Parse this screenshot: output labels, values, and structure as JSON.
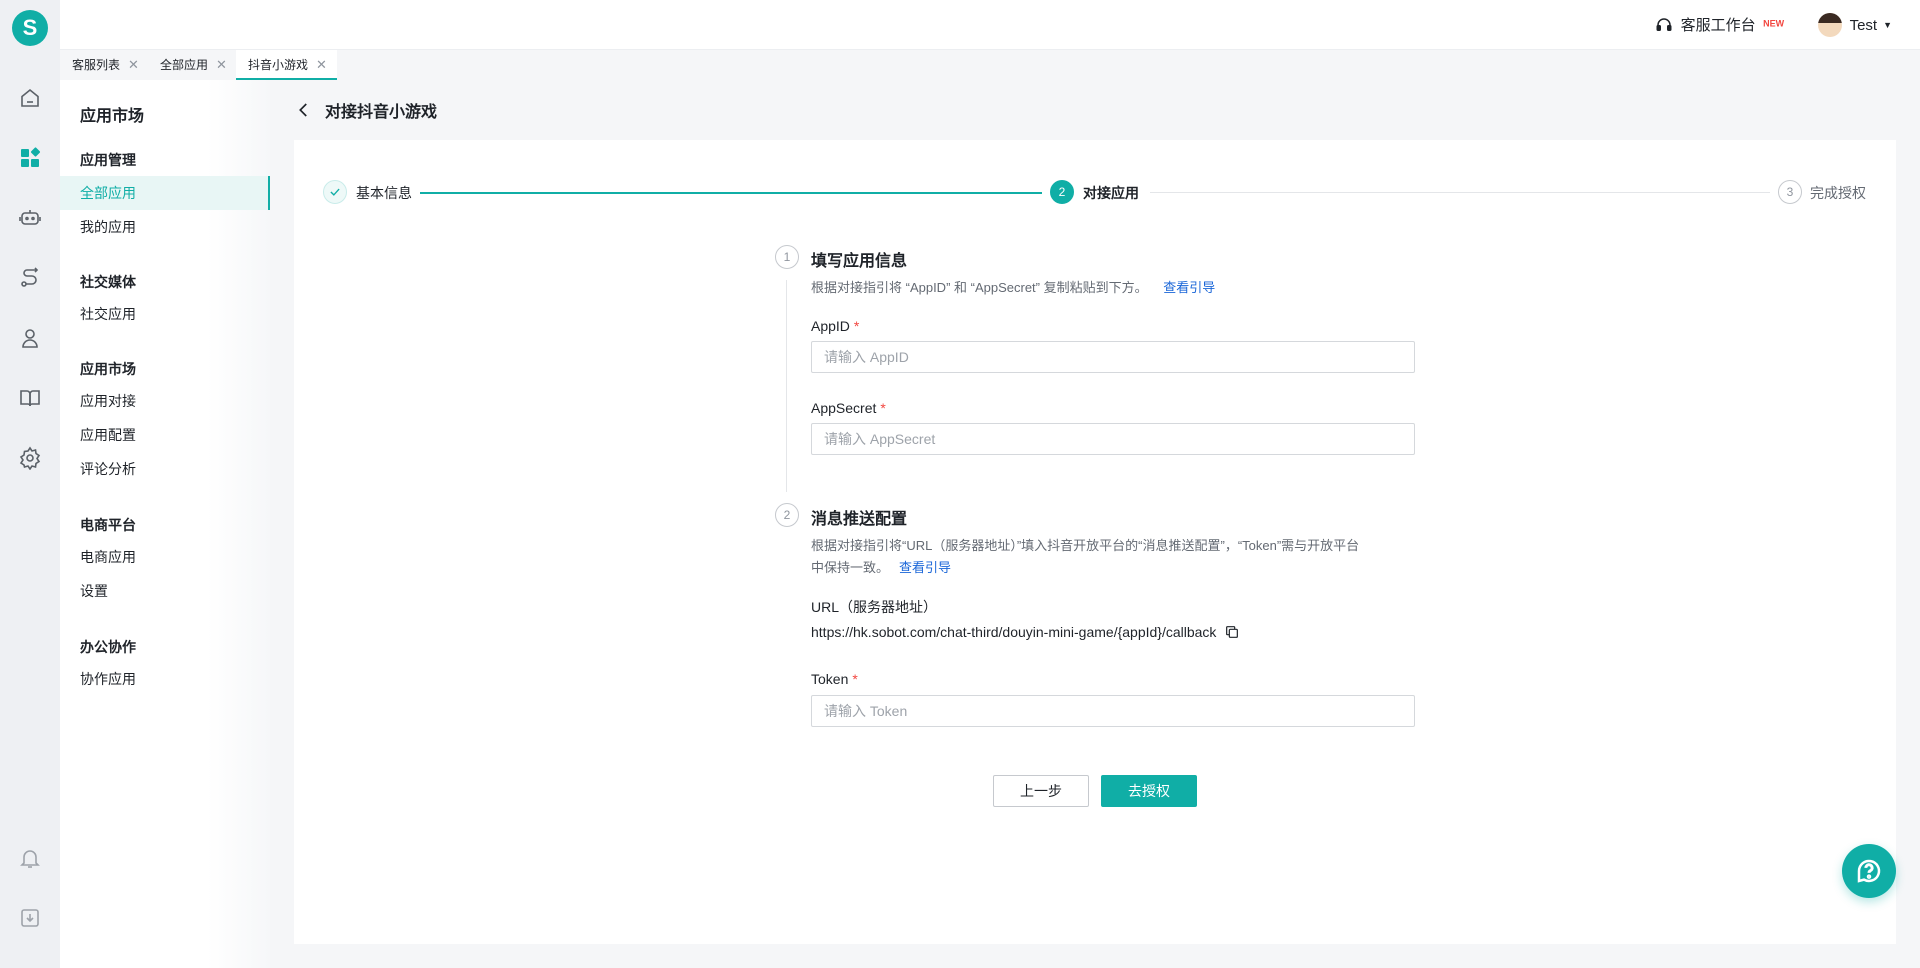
{
  "app": {
    "logo_letter": "S",
    "accent": "#10aea6"
  },
  "rail": {
    "icons": [
      "home-icon",
      "apps-icon",
      "robot-icon",
      "route-icon",
      "users-icon",
      "book-icon",
      "gear-icon",
      "bell-icon",
      "download-icon"
    ]
  },
  "header": {
    "workbench_label": "客服工作台",
    "new_badge": "NEW",
    "user_name": "Test"
  },
  "tabs": [
    {
      "label": "客服列表"
    },
    {
      "label": "全部应用"
    },
    {
      "label": "抖音小游戏",
      "active": true
    }
  ],
  "sidebar": {
    "title": "应用市场",
    "groups": [
      {
        "title": "应用管理",
        "items": [
          {
            "label": "全部应用",
            "active": true
          },
          {
            "label": "我的应用"
          }
        ]
      },
      {
        "title": "社交媒体",
        "items": [
          {
            "label": "社交应用"
          }
        ]
      },
      {
        "title": "应用市场",
        "items": [
          {
            "label": "应用对接"
          },
          {
            "label": "应用配置"
          },
          {
            "label": "评论分析"
          }
        ]
      },
      {
        "title": "电商平台",
        "items": [
          {
            "label": "电商应用"
          },
          {
            "label": "设置"
          }
        ]
      },
      {
        "title": "办公协作",
        "items": [
          {
            "label": "协作应用"
          }
        ]
      }
    ]
  },
  "page": {
    "title": "对接抖音小游戏"
  },
  "steps": [
    {
      "label": "基本信息",
      "status": "done"
    },
    {
      "label": "对接应用",
      "number": "2",
      "status": "active"
    },
    {
      "label": "完成授权",
      "number": "3",
      "status": "pending"
    }
  ],
  "section1": {
    "number": "1",
    "title": "填写应用信息",
    "desc": "根据对接指引将 “AppID” 和 “AppSecret” 复制粘贴到下方。",
    "link": "查看引导",
    "appid_label": "AppID",
    "appid_placeholder": "请输入 AppID",
    "appsecret_label": "AppSecret",
    "appsecret_placeholder": "请输入 AppSecret",
    "required_mark": "*"
  },
  "section2": {
    "number": "2",
    "title": "消息推送配置",
    "desc_line1": "根据对接指引将“URL（服务器地址）”填入抖音开放平台的“消息推送配置”，“Token”需与开放平台",
    "desc_line2": "中保持一致。",
    "link": "查看引导",
    "url_label": "URL（服务器地址）",
    "url_value": "https://hk.sobot.com/chat-third/douyin-mini-game/{appId}/callback",
    "token_label": "Token",
    "token_placeholder": "请输入 Token",
    "required_mark": "*"
  },
  "actions": {
    "prev_label": "上一步",
    "next_label": "去授权"
  }
}
